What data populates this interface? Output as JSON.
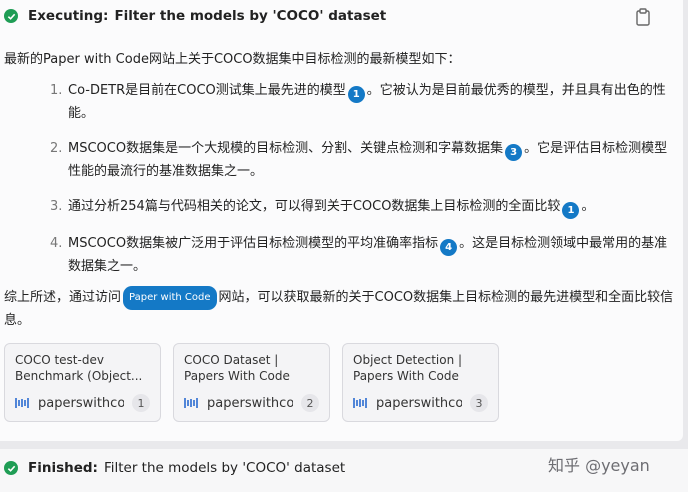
{
  "executing": {
    "label": "Executing:",
    "text": "Filter the models by 'COCO' dataset"
  },
  "copy_icon": "clipboard-icon",
  "intro": "最新的Paper with Code网站上关于COCO数据集中目标检测的最新模型如下：",
  "items": [
    {
      "num": "1.",
      "before": "Co-DETR是目前在COCO测试集上最先进的模型",
      "cite": "1",
      "after": "。它被认为是目前最优秀的模型，并且具有出色的性能。"
    },
    {
      "num": "2.",
      "before": "MSCOCO数据集是一个大规模的目标检测、分割、关键点检测和字幕数据集",
      "cite": "3",
      "after": "。它是评估目标检测模型性能的最流行的基准数据集之一。"
    },
    {
      "num": "3.",
      "before": "通过分析254篇与代码相关的论文，可以得到关于COCO数据集上目标检测的全面比较",
      "cite": "1",
      "after": "。"
    },
    {
      "num": "4.",
      "before": "MSCOCO数据集被广泛用于评估目标检测模型的平均准确率指标",
      "cite": "4",
      "after": "。这是目标检测领域中最常用的基准数据集之一。"
    }
  ],
  "summary": {
    "before": "综上所述，通过访问",
    "pill": "Paper with Code",
    "after": "网站，可以获取最新的关于COCO数据集上目标检测的最先进模型和全面比较信息。"
  },
  "sources": [
    {
      "title": "COCO test-dev Benchmark (Object...",
      "site": "paperswithco",
      "num": "1"
    },
    {
      "title": "COCO Dataset | Papers With Code",
      "site": "paperswithco",
      "num": "2"
    },
    {
      "title": "Object Detection | Papers With Code",
      "site": "paperswithco",
      "num": "3"
    }
  ],
  "finished": {
    "label": "Finished:",
    "text": "Filter the models by 'COCO' dataset"
  },
  "watermark": "知乎 @yeyan",
  "colors": {
    "accent": "#1479c6",
    "success": "#1f9d55"
  }
}
